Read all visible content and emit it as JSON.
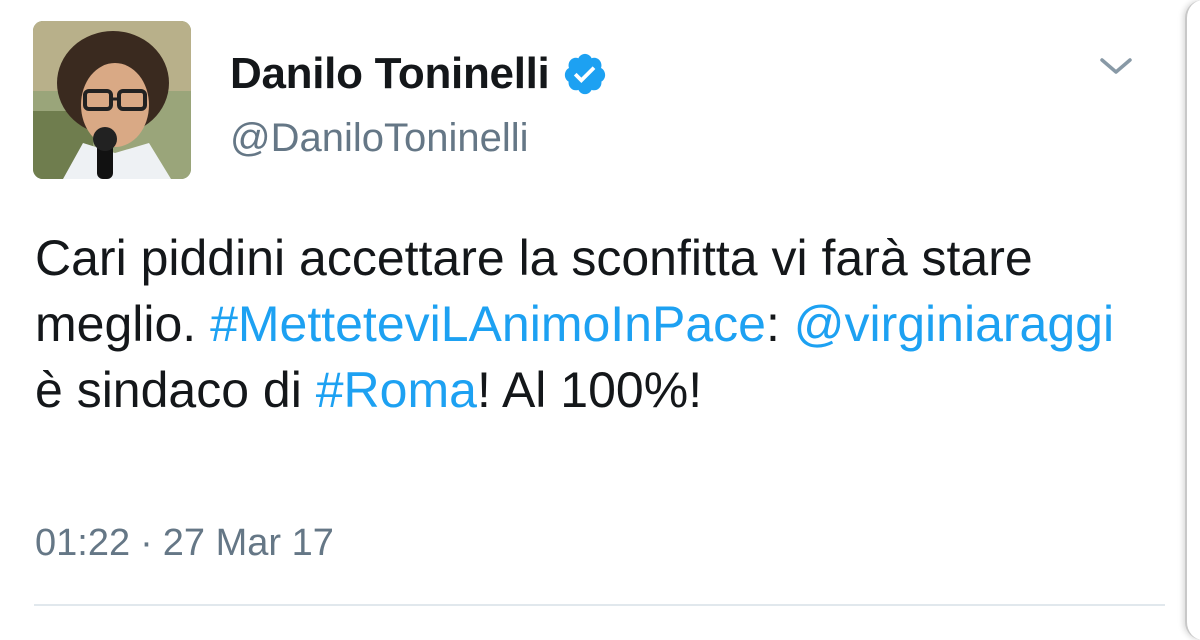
{
  "user": {
    "display_name": "Danilo Toninelli",
    "handle": "@DaniloToninelli",
    "verified": true,
    "avatar_icon": "profile-photo"
  },
  "tweet": {
    "segments": [
      {
        "text": "Cari piddini accettare la sconfitta vi farà stare meglio. ",
        "link": false
      },
      {
        "text": "#MetteteviLAnimoInPace",
        "link": true
      },
      {
        "text": ": ",
        "link": false
      },
      {
        "text": "@virginiaraggi",
        "link": true
      },
      {
        "text": " è sindaco di ",
        "link": false
      },
      {
        "text": "#Roma",
        "link": true
      },
      {
        "text": "! Al 100%!",
        "link": false
      }
    ],
    "time": "01:22",
    "separator": "·",
    "date": "27 Mar 17"
  },
  "icons": {
    "verified": "verified-badge-icon",
    "menu": "chevron-down-icon"
  },
  "colors": {
    "link": "#1da1f2",
    "verified": "#1da1f2",
    "secondary_text": "#657786",
    "primary_text": "#14171a",
    "divider": "#e1e8ed"
  }
}
